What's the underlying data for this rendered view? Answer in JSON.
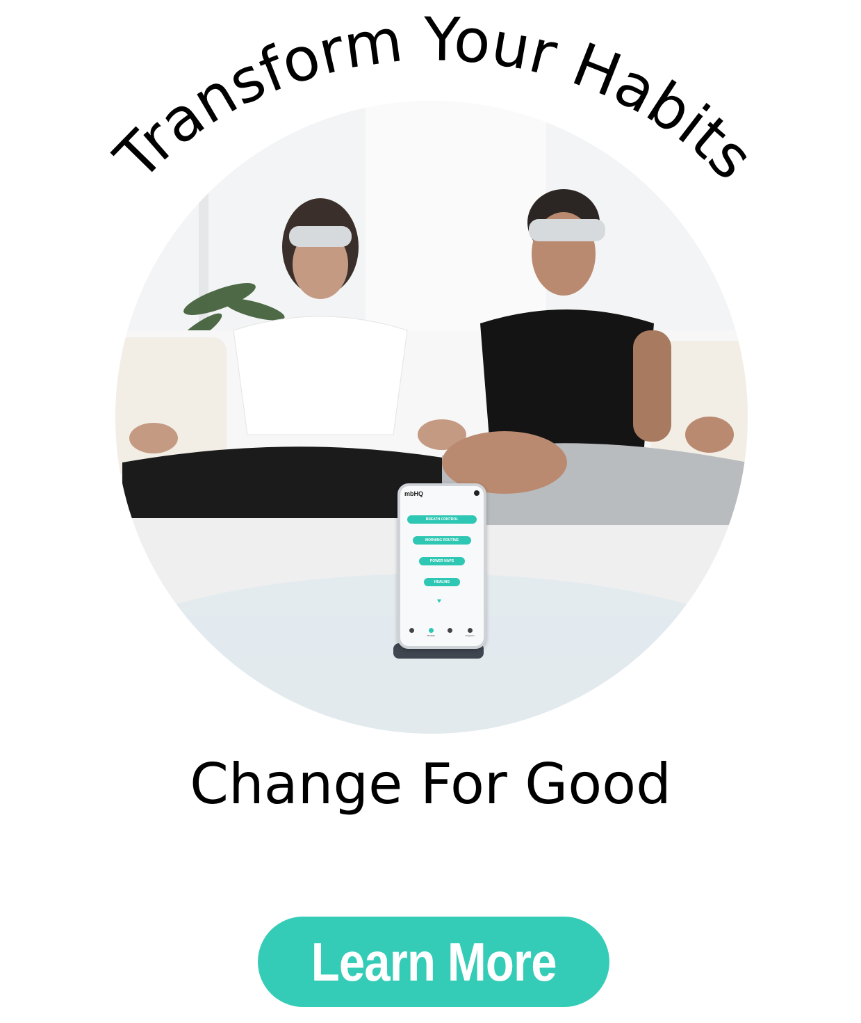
{
  "header": {
    "title": "Transform Your Habits"
  },
  "hero": {
    "phone": {
      "brand": "mbHQ",
      "menu_items": [
        "BREATH CONTROL",
        "MORNING ROUTINE",
        "POWER NAPS",
        "HEALING"
      ],
      "nav": [
        "Meditate",
        "Programs"
      ]
    }
  },
  "subtitle": "Change For Good",
  "cta": {
    "label": "Learn More",
    "color": "#35ccb7"
  }
}
